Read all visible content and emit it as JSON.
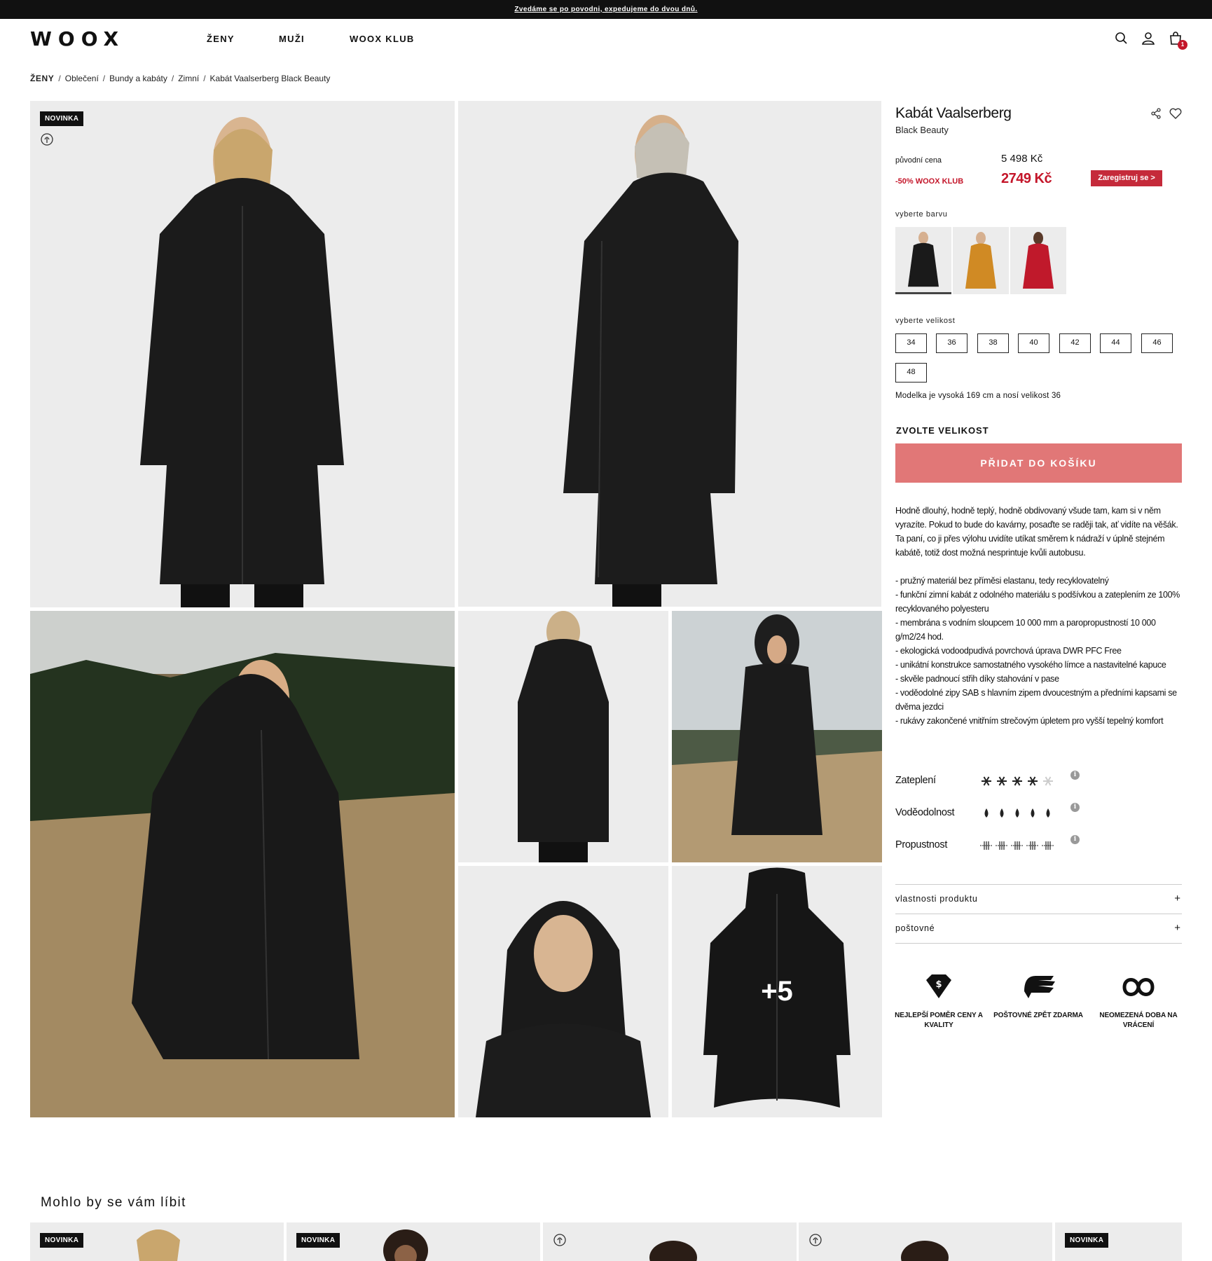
{
  "announcement": "Zvedáme se po povodni, expedujeme do dvou dnů.",
  "logo": "WOOX",
  "nav": [
    "ŽENY",
    "MUŽI",
    "WOOX KLUB"
  ],
  "header_icons": [
    "search-icon",
    "user-icon",
    "cart-icon"
  ],
  "cart_count": "1",
  "breadcrumb": [
    "ŽENY",
    "Oblečení",
    "Bundy a kabáty",
    "Zimní",
    "Kabát Vaalserberg Black Beauty"
  ],
  "gallery": {
    "badge": "NOVINKA",
    "more_count": "+5"
  },
  "product": {
    "title": "Kabát Vaalserberg",
    "subtitle": "Black Beauty",
    "original_label": "původní cena",
    "original_price": "5 498 Kč",
    "club_label": "-50% WOOX KLUB",
    "club_price": "2749 Kč",
    "register_label": "Zaregistruj se >",
    "color_label": "vyberte barvu",
    "colors": [
      {
        "name": "black",
        "hex": "#1a1a1a",
        "selected": true
      },
      {
        "name": "mustard",
        "hex": "#d08a24",
        "selected": false
      },
      {
        "name": "red",
        "hex": "#c0192b",
        "selected": false
      }
    ],
    "size_label": "vyberte  velikost",
    "sizes": [
      "34",
      "36",
      "38",
      "40",
      "42",
      "44",
      "46",
      "48"
    ],
    "model_note": "Modelka je vysoká 169 cm a nosí velikost 36",
    "choose_size": "ZVOLTE VELIKOST",
    "add_to_cart": "PŘIDAT DO KOŠÍKU",
    "description": "Hodně dlouhý, hodně teplý, hodně obdivovaný všude tam, kam si v něm vyrazíte. Pokud to bude do kavárny, posaďte se raději tak, ať vidíte na věšák. Ta paní, co ji přes výlohu uvidíte utíkat směrem k nádraží v úplně stejném kabátě, totiž dost možná nesprintuje kvůli autobusu.",
    "features": [
      "- pružný materiál bez příměsi elastanu, tedy recyklovatelný",
      "- funkční zimní kabát z odolného materiálu s podšívkou a zateplením ze 100% recyklovaného polyesteru",
      "- membrána s vodním sloupcem 10 000 mm a paropropustností 10 000 g/m2/24 hod.",
      "- ekologická vodoodpudivá povrchová úprava DWR PFC Free",
      "- unikátní konstrukce samostatného vysokého límce a nastavitelné kapuce",
      "- skvěle padnoucí střih díky stahování v pase",
      "- voděodolné zipy SAB s hlavním zipem dvoucestným a předními kapsami se dvěma jezdci",
      "- rukávy zakončené vnitřním strečovým úpletem pro vyšší tepelný komfort"
    ],
    "ratings": [
      {
        "label": "Zateplení",
        "icon": "snowflake-icon",
        "value": 4,
        "max": 5
      },
      {
        "label": "Voděodolnost",
        "icon": "drop-icon",
        "value": 5,
        "max": 5
      },
      {
        "label": "Propustnost",
        "icon": "vapor-icon",
        "value": 5,
        "max": 5
      }
    ],
    "info_glyph": "i",
    "accordions": [
      {
        "label": "vlastnosti produktu",
        "icon": "+"
      },
      {
        "label": "poštovné",
        "icon": "+"
      }
    ],
    "usps": [
      {
        "icon": "diamond-icon",
        "label": "NEJLEPŠÍ POMĚR CENY A KVALITY"
      },
      {
        "icon": "wing-icon",
        "label": "POŠTOVNÉ ZPĚT ZDARMA"
      },
      {
        "icon": "infinity-icon",
        "label": "NEOMEZENÁ DOBA NA VRÁCENÍ"
      }
    ]
  },
  "recommendations": {
    "title": "Mohlo by se vám líbit",
    "cards": [
      {
        "badge": "NOVINKA"
      },
      {
        "badge": "NOVINKA"
      },
      {
        "badge": ""
      },
      {
        "badge": ""
      },
      {
        "badge": "NOVINKA"
      }
    ]
  },
  "colors": {
    "accent": "#c4162a",
    "cart_button": "#e17777",
    "register_button": "#c52a3a",
    "photo_bg": "#ececec"
  }
}
